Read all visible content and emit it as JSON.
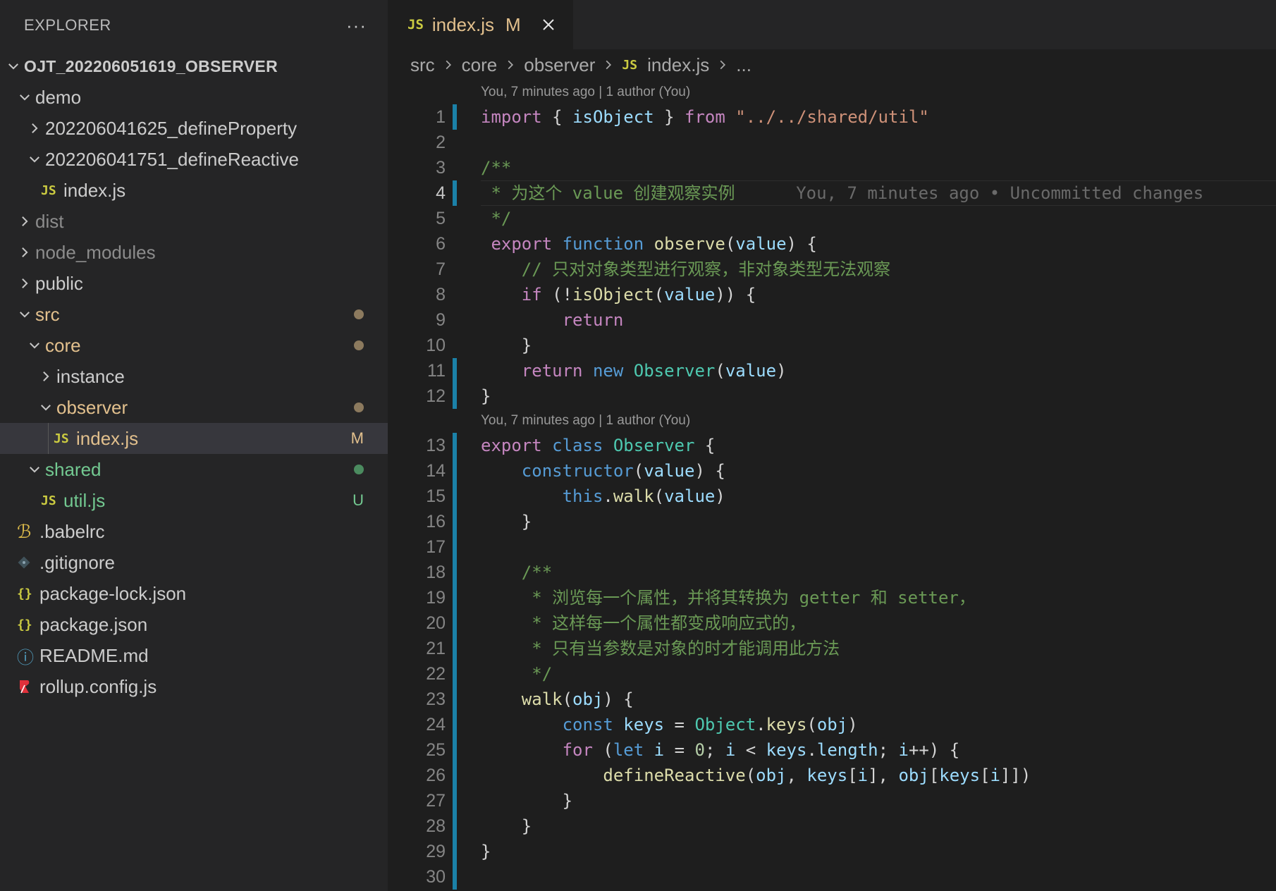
{
  "sidebar": {
    "title": "EXPLORER",
    "more_label": "···",
    "root": "OJT_202206051619_OBSERVER",
    "items": [
      {
        "label": "demo"
      },
      {
        "label": "202206041625_defineProperty"
      },
      {
        "label": "202206041751_defineReactive"
      },
      {
        "label": "index.js"
      },
      {
        "label": "dist"
      },
      {
        "label": "node_modules"
      },
      {
        "label": "public"
      },
      {
        "label": "src"
      },
      {
        "label": "core"
      },
      {
        "label": "instance"
      },
      {
        "label": "observer"
      },
      {
        "label": "index.js",
        "status": "M"
      },
      {
        "label": "shared"
      },
      {
        "label": "util.js",
        "status": "U"
      },
      {
        "label": ".babelrc"
      },
      {
        "label": ".gitignore"
      },
      {
        "label": "package-lock.json"
      },
      {
        "label": "package.json"
      },
      {
        "label": "README.md"
      },
      {
        "label": "rollup.config.js"
      }
    ]
  },
  "tab": {
    "icon": "JS",
    "name": "index.js",
    "status": "M"
  },
  "breadcrumb": [
    "src",
    "core",
    "observer",
    "index.js",
    "..."
  ],
  "codelens": [
    "You, 7 minutes ago | 1 author (You)",
    "You, 7 minutes ago | 1 author (You)"
  ],
  "blame": "You, 7 minutes ago • Uncommitted changes",
  "icons": {
    "js": "JS",
    "json": "{}",
    "babel": "ℬ",
    "info": "ⓘ"
  },
  "colors": {
    "modified": "#e2c08d",
    "untracked": "#73c991",
    "gutter_bar": "#1b81a8"
  }
}
